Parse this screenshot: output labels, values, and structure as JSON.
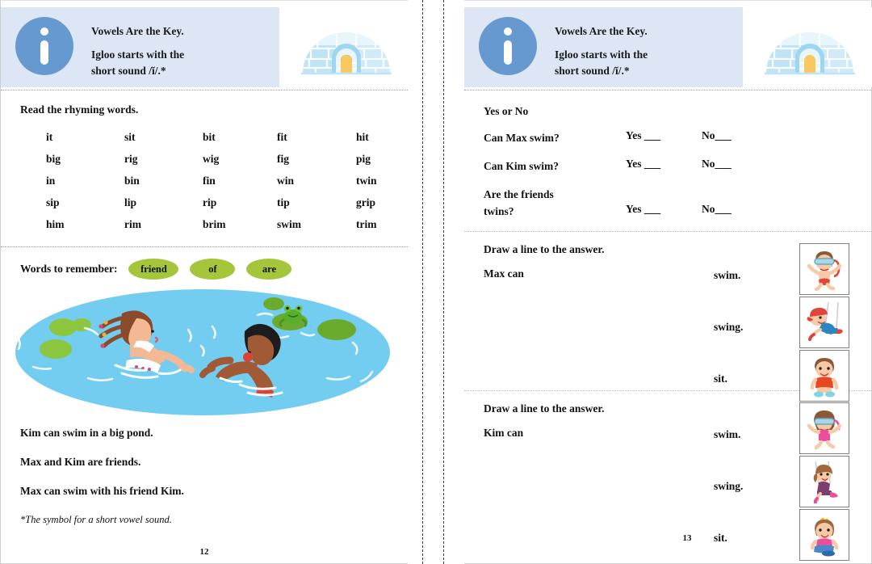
{
  "header": {
    "letter": "i",
    "title": "Vowels Are the Key.",
    "subtitle_line1": "Igloo starts with the",
    "subtitle_line2": "short sound /ĭ/.*",
    "icon": "igloo-illustration",
    "band_color": "#dce6f5",
    "circle_color": "#6699cf"
  },
  "left_page": {
    "rhyme_heading": "Read the rhyming words.",
    "rhyme_rows": [
      [
        "it",
        "sit",
        "bit",
        "fit",
        "hit"
      ],
      [
        "big",
        "rig",
        "wig",
        "fig",
        "pig"
      ],
      [
        "in",
        "bin",
        "fin",
        "win",
        "twin"
      ],
      [
        "sip",
        "lip",
        "rip",
        "tip",
        "grip"
      ],
      [
        "him",
        "rim",
        "brim",
        "swim",
        "trim"
      ]
    ],
    "words_to_remember_label": "Words to remember:",
    "words_to_remember": [
      "friend",
      "of",
      "are"
    ],
    "pill_color": "#a5c63b",
    "illustration": "two-children-swimming-in-pond",
    "pond_color": "#72cdf0",
    "story": [
      "Kim can swim in a big pond.",
      "Max and Kim are friends.",
      "Max can swim with his friend Kim."
    ],
    "footnote": "*The symbol for a short vowel sound.",
    "page_number": "12"
  },
  "right_page": {
    "yes_no_heading": "Yes or No",
    "yes_label": "Yes ___",
    "no_label": "No___",
    "questions": [
      {
        "text": "Can Max swim?",
        "text_line2": ""
      },
      {
        "text": "Can Kim swim?",
        "text_line2": ""
      },
      {
        "text": "Are the friends",
        "text_line2": "twins?"
      }
    ],
    "draw_blocks": [
      {
        "heading": "Draw a line to the answer.",
        "subject": "Max can",
        "options": [
          "swim.",
          "swing.",
          "sit."
        ],
        "images": [
          "boy-swimming-icon",
          "boy-swinging-icon",
          "boy-sitting-icon"
        ]
      },
      {
        "heading": "Draw a line to the answer.",
        "subject": "Kim can",
        "options": [
          "swim.",
          "swing.",
          "sit."
        ],
        "images": [
          "girl-swimming-icon",
          "girl-swinging-icon",
          "girl-sitting-icon"
        ]
      }
    ],
    "page_number": "13"
  }
}
